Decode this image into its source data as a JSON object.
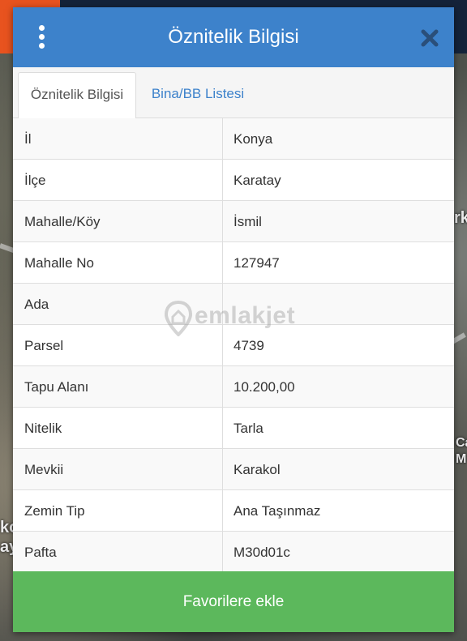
{
  "header": {
    "title": "Öznitelik Bilgisi",
    "menu_icon": "more-vertical-icon",
    "close_icon": "close-icon",
    "color": "#3d82cb"
  },
  "tabs": [
    {
      "label": "Öznitelik Bilgisi",
      "active": true
    },
    {
      "label": "Bina/BB Listesi",
      "active": false
    }
  ],
  "attributes": [
    {
      "label": "İl",
      "value": "Konya"
    },
    {
      "label": "İlçe",
      "value": "Karatay"
    },
    {
      "label": "Mahalle/Köy",
      "value": "İsmil"
    },
    {
      "label": "Mahalle No",
      "value": "127947"
    },
    {
      "label": "Ada",
      "value": ""
    },
    {
      "label": "Parsel",
      "value": "4739"
    },
    {
      "label": "Tapu Alanı",
      "value": "10.200,00"
    },
    {
      "label": "Nitelik",
      "value": "Tarla"
    },
    {
      "label": "Mevkii",
      "value": "Karakol"
    },
    {
      "label": "Zemin Tip",
      "value": "Ana Taşınmaz"
    },
    {
      "label": "Pafta",
      "value": "M30d01c"
    }
  ],
  "watermark": {
    "text": "emlakjet",
    "icon": "location-pin-icon"
  },
  "footer": {
    "favorite_label": "Favorilere ekle",
    "color": "#5cb85c"
  },
  "map": {
    "labels": [
      "rk",
      "Ca",
      "M",
      "ko",
      "ay"
    ]
  }
}
